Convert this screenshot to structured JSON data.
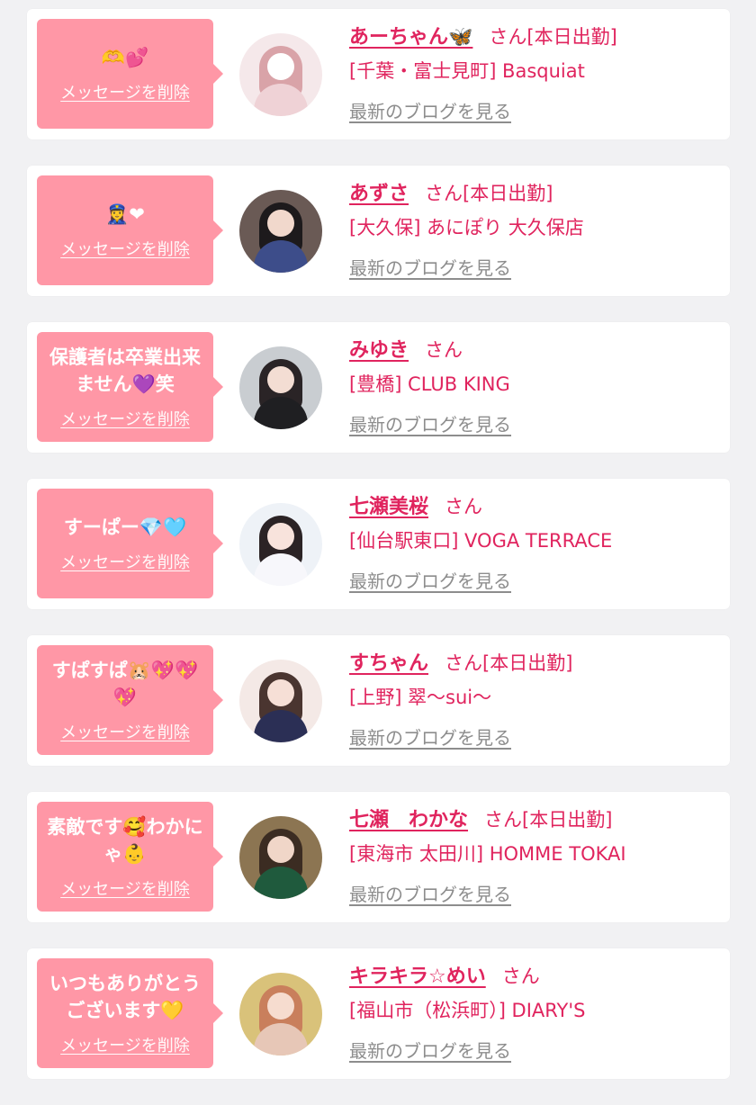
{
  "colors": {
    "background": "#f1f1f3",
    "card": "#ffffff",
    "bubble": "#ff97a6",
    "accent": "#e0245e",
    "blog_link": "#8d8d8d"
  },
  "cards": [
    {
      "message": "🫶💕",
      "delete_label": "メッセージを削除",
      "name": "あーちゃん🦋",
      "honorific": "さん",
      "status": "[本日出勤]",
      "shop": "[千葉・富士見町] Basquiat",
      "blog_label": "最新のブログを見る",
      "avatar_icon": "avatar-photo-heart-cover",
      "avatar_colors": {
        "bg": "#f5e8ea",
        "hair": "#d9a3a8",
        "face": "#ffffff",
        "body": "#efd2d6"
      }
    },
    {
      "message": "👮‍♀️❤",
      "delete_label": "メッセージを削除",
      "name": "あずさ",
      "honorific": "さん",
      "status": "[本日出勤]",
      "shop": "[大久保] あにぽり 大久保店",
      "blog_label": "最新のブログを見る",
      "avatar_icon": "avatar-photo-police-uniform",
      "avatar_colors": {
        "bg": "#6a5a55",
        "hair": "#1d1a1c",
        "face": "#f1d8cc",
        "body": "#3d4d8a"
      }
    },
    {
      "message": "保護者は卒業出来ません💜笑",
      "delete_label": "メッセージを削除",
      "name": "みゆき",
      "honorific": "さん",
      "status": "",
      "shop": "[豊橋] CLUB KING",
      "blog_label": "最新のブログを見る",
      "avatar_icon": "avatar-photo-cat-ears",
      "avatar_colors": {
        "bg": "#c9cdd1",
        "hair": "#2a2426",
        "face": "#f3ddd3",
        "body": "#1f1f22"
      }
    },
    {
      "message": "すーぱー💎🩵",
      "delete_label": "メッセージを削除",
      "name": "七瀬美桜",
      "honorific": "さん",
      "status": "",
      "shop": "[仙台駅東口] VOGA TERRACE",
      "blog_label": "最新のブログを見る",
      "avatar_icon": "avatar-photo-lying-pose",
      "avatar_colors": {
        "bg": "#eef2f7",
        "hair": "#2b2325",
        "face": "#f8e3dc",
        "body": "#f7f7fb"
      }
    },
    {
      "message": "すぱすぱ🐹💖💖💖",
      "delete_label": "メッセージを削除",
      "name": "すちゃん",
      "honorific": "さん",
      "status": "[本日出勤]",
      "shop": "[上野] 翠〜sui〜",
      "blog_label": "最新のブログを見る",
      "avatar_icon": "avatar-photo-navy-dress",
      "avatar_colors": {
        "bg": "#f4e9e6",
        "hair": "#4a3530",
        "face": "#f6dfd6",
        "body": "#2b2f55"
      }
    },
    {
      "message": "素敵です🥰わかにゃ👶",
      "delete_label": "メッセージを削除",
      "name": "七瀬　わかな",
      "honorific": "さん",
      "status": "[本日出勤]",
      "shop": "[東海市 太田川] HOMME TOKAI",
      "blog_label": "最新のブログを見る",
      "avatar_icon": "avatar-photo-magazine-cover",
      "avatar_colors": {
        "bg": "#8c7552",
        "hair": "#3b2c22",
        "face": "#f0d6c8",
        "body": "#1f5a3d"
      }
    },
    {
      "message": "いつもありがとうございます💛",
      "delete_label": "メッセージを削除",
      "name": "キラキラ☆めい",
      "honorific": "さん",
      "status": "",
      "shop": "[福山市（松浜町）] DIARY'S",
      "blog_label": "最新のブログを見る",
      "avatar_icon": "avatar-photo-gold-sparkle",
      "avatar_colors": {
        "bg": "#d9c27a",
        "hair": "#c97f5c",
        "face": "#f6dccf",
        "body": "#e7c7b7"
      }
    }
  ]
}
